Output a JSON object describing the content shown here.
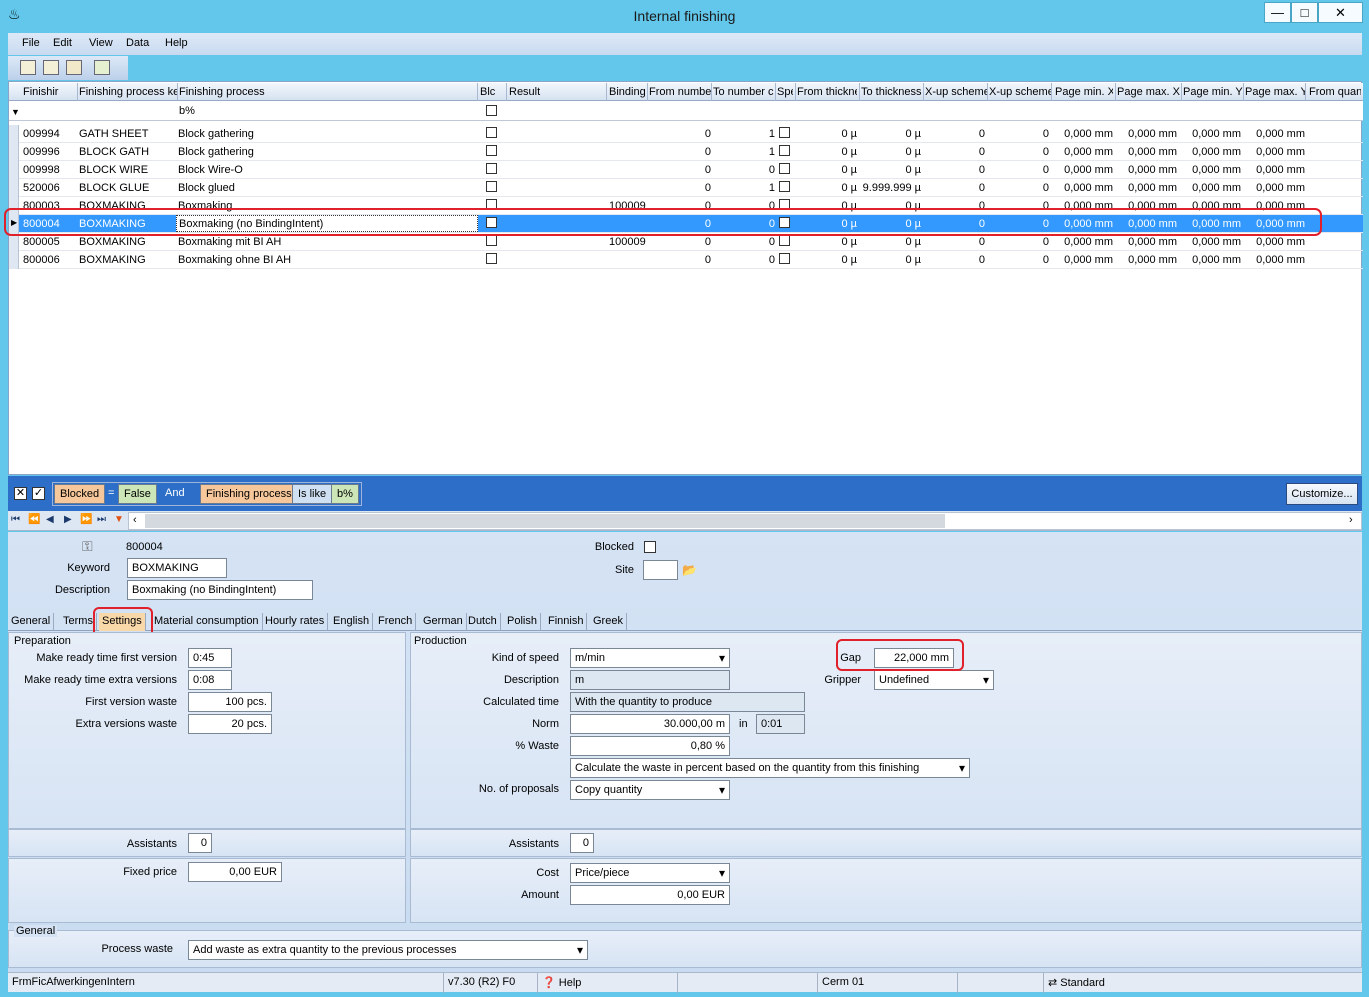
{
  "window": {
    "title": "Internal finishing",
    "min_icon": "minimize-icon",
    "max_icon": "maximize-icon",
    "close_icon": "close-icon"
  },
  "menu": [
    "File",
    "Edit",
    "View",
    "Data",
    "Help"
  ],
  "grid": {
    "columns": [
      "Finishir",
      "Finishing process ke",
      "Finishing process",
      "Blc",
      "Result",
      "Binding",
      "From numbe",
      "To number c",
      "Spe",
      "From thickne",
      "To thickness",
      "X-up scheme",
      "X-up scheme",
      "Page min. X",
      "Page max. X",
      "Page min. Y",
      "Page max. Y",
      "From quant"
    ],
    "filter_value": "b%",
    "rows": [
      {
        "no": "009994",
        "key": "GATH SHEET",
        "proc": "Block gathering",
        "binding": "",
        "from": "0",
        "to": "1",
        "fthick": "0 µ",
        "tthick": "0 µ",
        "x1": "0",
        "x2": "0",
        "pminx": "0,000 mm",
        "pmaxx": "0,000 mm",
        "pminy": "0,000 mm",
        "pmaxy": "0,000 mm"
      },
      {
        "no": "009996",
        "key": "BLOCK GATH",
        "proc": "Block gathering",
        "binding": "",
        "from": "0",
        "to": "1",
        "fthick": "0 µ",
        "tthick": "0 µ",
        "x1": "0",
        "x2": "0",
        "pminx": "0,000 mm",
        "pmaxx": "0,000 mm",
        "pminy": "0,000 mm",
        "pmaxy": "0,000 mm"
      },
      {
        "no": "009998",
        "key": "BLOCK WIRE",
        "proc": "Block Wire-O",
        "binding": "",
        "from": "0",
        "to": "0",
        "fthick": "0 µ",
        "tthick": "0 µ",
        "x1": "0",
        "x2": "0",
        "pminx": "0,000 mm",
        "pmaxx": "0,000 mm",
        "pminy": "0,000 mm",
        "pmaxy": "0,000 mm"
      },
      {
        "no": "520006",
        "key": "BLOCK GLUE",
        "proc": "Block glued",
        "binding": "",
        "from": "0",
        "to": "1",
        "fthick": "0 µ",
        "tthick": "9.999.999 µ",
        "x1": "0",
        "x2": "0",
        "pminx": "0,000 mm",
        "pmaxx": "0,000 mm",
        "pminy": "0,000 mm",
        "pmaxy": "0,000 mm"
      },
      {
        "no": "800003",
        "key": "BOXMAKING",
        "proc": "Boxmaking",
        "binding": "100009",
        "from": "0",
        "to": "0",
        "fthick": "0 µ",
        "tthick": "0 µ",
        "x1": "0",
        "x2": "0",
        "pminx": "0,000 mm",
        "pmaxx": "0,000 mm",
        "pminy": "0,000 mm",
        "pmaxy": "0,000 mm"
      },
      {
        "no": "800004",
        "key": "BOXMAKING",
        "proc": "Boxmaking (no BindingIntent)",
        "binding": "",
        "from": "0",
        "to": "0",
        "fthick": "0 µ",
        "tthick": "0 µ",
        "x1": "0",
        "x2": "0",
        "pminx": "0,000 mm",
        "pmaxx": "0,000 mm",
        "pminy": "0,000 mm",
        "pmaxy": "0,000 mm"
      },
      {
        "no": "800005",
        "key": "BOXMAKING",
        "proc": "Boxmaking mit BI AH",
        "binding": "100009",
        "from": "0",
        "to": "0",
        "fthick": "0 µ",
        "tthick": "0 µ",
        "x1": "0",
        "x2": "0",
        "pminx": "0,000 mm",
        "pmaxx": "0,000 mm",
        "pminy": "0,000 mm",
        "pmaxy": "0,000 mm"
      },
      {
        "no": "800006",
        "key": "BOXMAKING",
        "proc": "Boxmaking ohne BI AH",
        "binding": "",
        "from": "0",
        "to": "0",
        "fthick": "0 µ",
        "tthick": "0 µ",
        "x1": "0",
        "x2": "0",
        "pminx": "0,000 mm",
        "pmaxx": "0,000 mm",
        "pminy": "0,000 mm",
        "pmaxy": "0,000 mm"
      }
    ]
  },
  "filterbar": {
    "blocked": "Blocked",
    "eq": "=",
    "false": "False",
    "and": "And",
    "fp": "Finishing process",
    "islike": "Is like",
    "val": "b%",
    "customize": "Customize..."
  },
  "detail": {
    "id": "800004",
    "keyword_label": "Keyword",
    "keyword": "BOXMAKING",
    "desc_label": "Description",
    "desc": "Boxmaking (no BindingIntent)",
    "blocked_label": "Blocked",
    "site_label": "Site"
  },
  "tabs": [
    "General",
    "Terms",
    "Settings",
    "Material consumption",
    "Hourly rates",
    "English",
    "French",
    "German",
    "Dutch",
    "Polish",
    "Finnish",
    "Greek"
  ],
  "prep": {
    "title": "Preparation",
    "mr_first_label": "Make ready time first version",
    "mr_first": "0:45",
    "mr_extra_label": "Make ready time extra versions",
    "mr_extra": "0:08",
    "fv_waste_label": "First version waste",
    "fv_waste": "100 pcs.",
    "ev_waste_label": "Extra versions waste",
    "ev_waste": "20 pcs.",
    "assist_label": "Assistants",
    "assist": "0",
    "fixed_label": "Fixed price",
    "fixed": "0,00 EUR"
  },
  "prod": {
    "title": "Production",
    "speed_label": "Kind of speed",
    "speed": "m/min",
    "desc_label": "Description",
    "desc": "m",
    "calc_label": "Calculated time",
    "calc": "With the quantity to produce",
    "norm_label": "Norm",
    "norm": "30.000,00 m",
    "in": "in",
    "norm_time": "0:01",
    "waste_label": "% Waste",
    "waste": "0,80 %",
    "waste_mode": "Calculate the waste in percent based on the quantity from this finishing",
    "prop_label": "No. of proposals",
    "prop": "Copy quantity",
    "gap_label": "Gap",
    "gap": "22,000 mm",
    "gripper_label": "Gripper",
    "gripper": "Undefined",
    "assist_label": "Assistants",
    "assist": "0",
    "cost_label": "Cost",
    "cost": "Price/piece",
    "amount_label": "Amount",
    "amount": "0,00 EUR"
  },
  "general": {
    "title": "General",
    "pw_label": "Process waste",
    "pw": "Add waste as extra quantity to the previous processes"
  },
  "status": {
    "form": "FrmFicAfwerkingenIntern",
    "version": "v7.30 (R2) F0",
    "help": "Help",
    "user": "Cerm 01",
    "layout": "Standard"
  }
}
